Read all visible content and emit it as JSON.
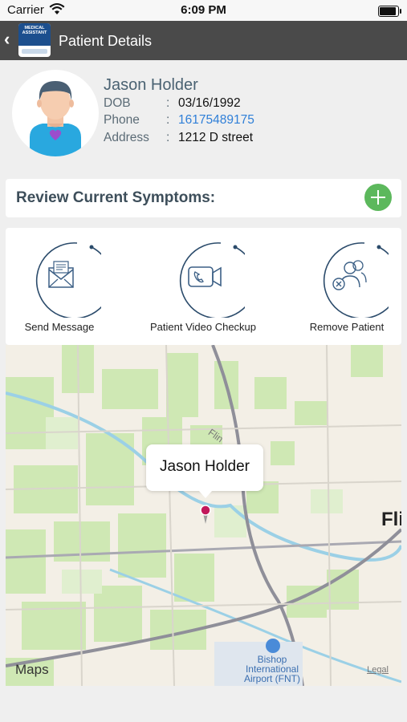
{
  "status_bar": {
    "carrier": "Carrier",
    "time": "6:09 PM",
    "battery_level": 0.95
  },
  "nav": {
    "back_icon": "chevron-left-icon",
    "logo_text": "MEDICAL ASSISTANT",
    "title": "Patient Details"
  },
  "patient": {
    "name": "Jason Holder",
    "dob_label": "DOB",
    "dob": "03/16/1992",
    "phone_label": "Phone",
    "phone": "16175489175",
    "address_label": "Address",
    "address": "1212 D street",
    "separator": ":"
  },
  "symptoms": {
    "title": "Review Current Symptoms:",
    "add_icon": "plus-circle-icon"
  },
  "actions": [
    {
      "label": "Send Message",
      "icon": "envelope-icon"
    },
    {
      "label": "Patient Video Checkup",
      "icon": "video-call-icon"
    },
    {
      "label": "Remove Patient",
      "icon": "remove-user-icon"
    }
  ],
  "map": {
    "callout": "Jason Holder",
    "city_partial": "Fli",
    "airport": "Bishop International Airport (FNT)",
    "river_label": "Flin",
    "attribution": "Maps",
    "legal": "Legal"
  },
  "colors": {
    "nav_bg": "#4a4a4a",
    "add_button": "#5cb85c",
    "link": "#2f7fd8",
    "ring": "#2b4b6b",
    "pin": "#c2185b"
  }
}
